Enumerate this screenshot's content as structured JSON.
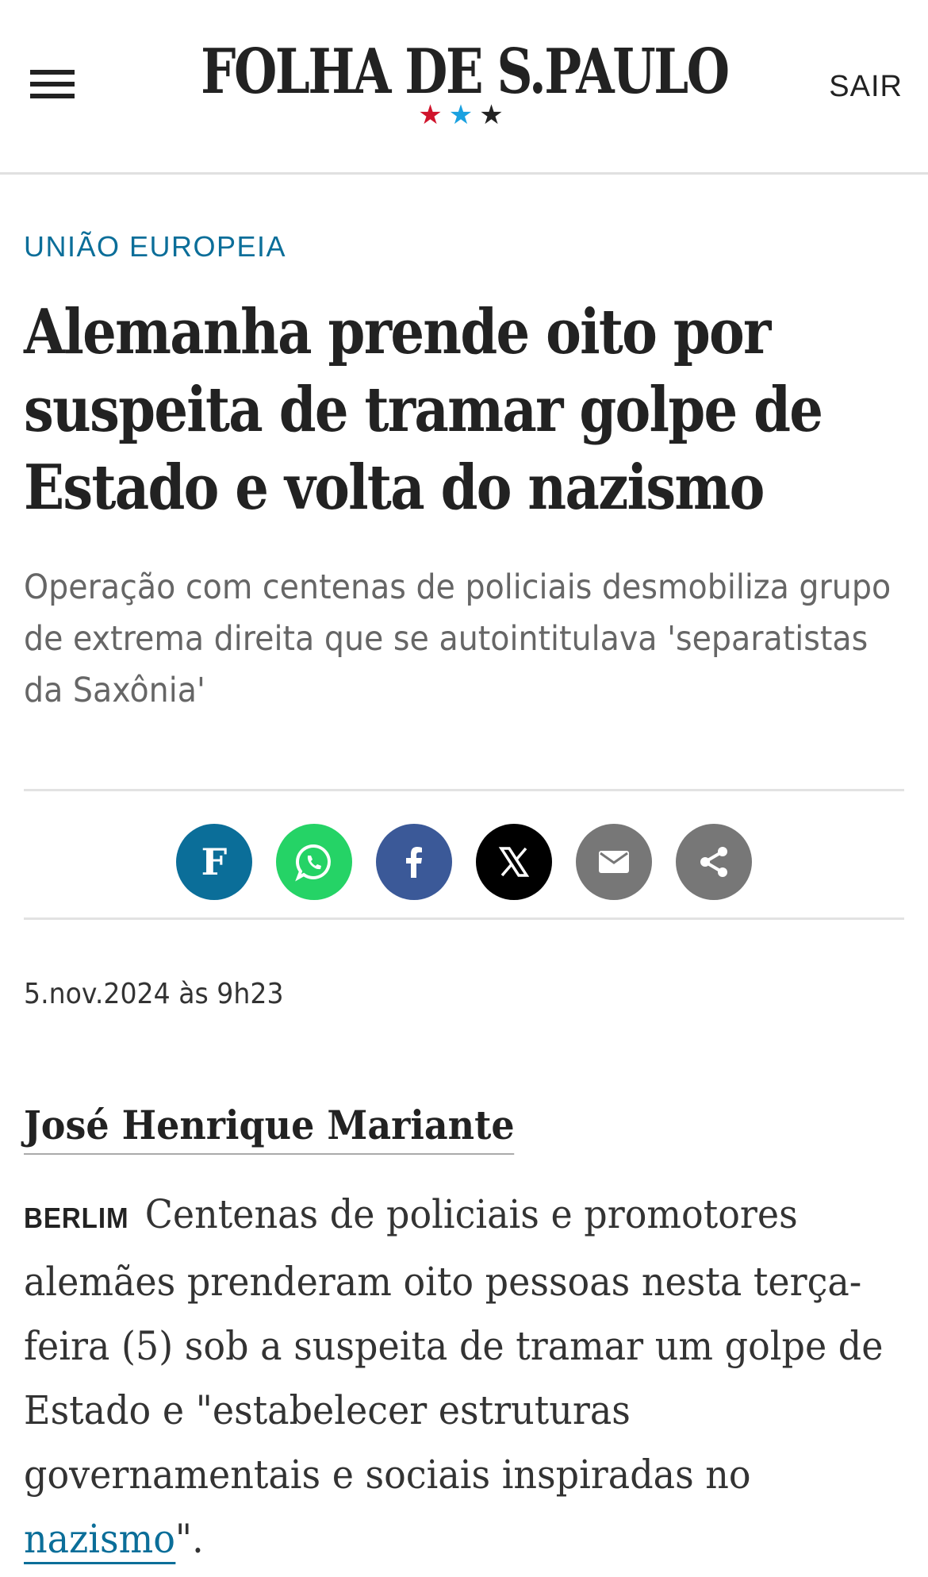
{
  "header": {
    "logo": "FOLHA DE S.PAULO",
    "stars": [
      "★",
      "★",
      "★"
    ],
    "logout_label": "SAIR"
  },
  "article": {
    "kicker": "UNIÃO EUROPEIA",
    "headline": "Alemanha prende oito por suspeita de tramar golpe de Estado e volta do nazismo",
    "subtitle": "Operação com centenas de policiais desmobiliza grupo de extrema direita que se autointitulava 'separatistas da Saxônia'",
    "date": "5.nov.2024 às 9h23",
    "author": "José Henrique Mariante",
    "dateline": "BERLIM",
    "body_before_link": "Centenas de policiais e promotores alemães prenderam oito pessoas nesta terça-feira (5) sob a suspeita de tramar um golpe de Estado e \"estabelecer estruturas governamentais e sociais inspiradas no ",
    "body_link": "nazismo",
    "body_after_link": "\"."
  },
  "share": {
    "buttons": [
      {
        "name": "folha",
        "color": "#0b6e99"
      },
      {
        "name": "whatsapp",
        "color": "#25d366"
      },
      {
        "name": "facebook",
        "color": "#3b5998"
      },
      {
        "name": "x",
        "color": "#000000"
      },
      {
        "name": "email",
        "color": "#777777"
      },
      {
        "name": "share",
        "color": "#777777"
      }
    ]
  }
}
